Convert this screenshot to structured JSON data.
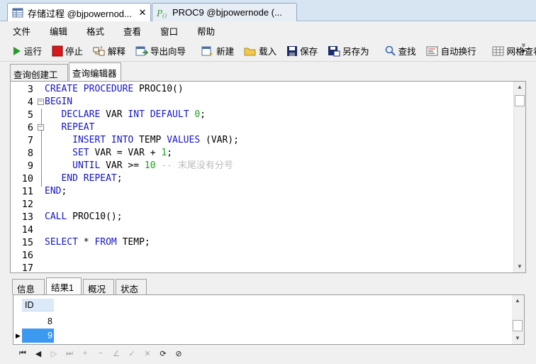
{
  "window_tabs": [
    {
      "label": "存储过程 @bjpowernod...",
      "close": "✕"
    },
    {
      "label": "PROC9 @bjpowernode (..."
    }
  ],
  "menu": [
    "文件",
    "编辑",
    "格式",
    "查看",
    "窗口",
    "帮助"
  ],
  "toolbar": {
    "run": "运行",
    "stop": "停止",
    "explain": "解释",
    "export_wizard": "导出向导",
    "new": "新建",
    "load": "载入",
    "save": "保存",
    "save_as": "另存为",
    "find": "查找",
    "word_wrap": "自动换行",
    "grid_view": "网格查看",
    "more": "»"
  },
  "editor_tabs": [
    "查询创建工具",
    "查询编辑器"
  ],
  "code_lines": [
    {
      "n": "3",
      "fold": "",
      "tokens": [
        {
          "t": "CREATE PROCEDURE",
          "c": "kw"
        },
        {
          "t": " PROC10()",
          "c": "txt"
        }
      ]
    },
    {
      "n": "4",
      "fold": "⊟",
      "tokens": [
        {
          "t": "BEGIN",
          "c": "kw"
        }
      ]
    },
    {
      "n": "5",
      "fold": "",
      "tokens": [
        {
          "t": "   DECLARE",
          "c": "kw"
        },
        {
          "t": " VAR ",
          "c": "txt"
        },
        {
          "t": "INT DEFAULT",
          "c": "kw"
        },
        {
          "t": " ",
          "c": "txt"
        },
        {
          "t": "0",
          "c": "num"
        },
        {
          "t": ";",
          "c": "txt"
        }
      ]
    },
    {
      "n": "6",
      "fold": "⊟",
      "tokens": [
        {
          "t": "   REPEAT",
          "c": "kw"
        }
      ]
    },
    {
      "n": "7",
      "fold": "",
      "tokens": [
        {
          "t": "     INSERT INTO",
          "c": "kw"
        },
        {
          "t": " TEMP ",
          "c": "txt"
        },
        {
          "t": "VALUES",
          "c": "kw"
        },
        {
          "t": " (VAR);",
          "c": "txt"
        }
      ]
    },
    {
      "n": "8",
      "fold": "",
      "tokens": [
        {
          "t": "     SET",
          "c": "kw"
        },
        {
          "t": " VAR = VAR + ",
          "c": "txt"
        },
        {
          "t": "1",
          "c": "num"
        },
        {
          "t": ";",
          "c": "txt"
        }
      ]
    },
    {
      "n": "9",
      "fold": "",
      "tokens": [
        {
          "t": "     UNTIL",
          "c": "kw"
        },
        {
          "t": " VAR >= ",
          "c": "txt"
        },
        {
          "t": "10",
          "c": "num"
        },
        {
          "t": " -- 末尾没有分号",
          "c": "cmt"
        }
      ]
    },
    {
      "n": "10",
      "fold": "",
      "tokens": [
        {
          "t": "   END REPEAT",
          "c": "kw"
        },
        {
          "t": ";",
          "c": "txt"
        }
      ]
    },
    {
      "n": "11",
      "fold": "",
      "tokens": [
        {
          "t": "END",
          "c": "kw"
        },
        {
          "t": ";",
          "c": "txt"
        }
      ]
    },
    {
      "n": "12",
      "fold": "",
      "tokens": []
    },
    {
      "n": "13",
      "fold": "",
      "tokens": [
        {
          "t": "CALL",
          "c": "kw"
        },
        {
          "t": " PROC10();",
          "c": "txt"
        }
      ]
    },
    {
      "n": "14",
      "fold": "",
      "tokens": []
    },
    {
      "n": "15",
      "fold": "",
      "tokens": [
        {
          "t": "SELECT",
          "c": "kw"
        },
        {
          "t": " * ",
          "c": "txt"
        },
        {
          "t": "FROM",
          "c": "kw"
        },
        {
          "t": " TEMP;",
          "c": "txt"
        }
      ]
    },
    {
      "n": "16",
      "fold": "",
      "tokens": []
    },
    {
      "n": "17",
      "fold": "",
      "tokens": []
    }
  ],
  "result_tabs": [
    "信息",
    "结果1",
    "概况",
    "状态"
  ],
  "result_grid": {
    "column": "ID",
    "rows": [
      "8",
      "9"
    ],
    "current_row_marker": "▶"
  },
  "navigator": [
    "first-icon",
    "prev-icon",
    "next-icon",
    "last-icon",
    "insert-icon",
    "delete-icon",
    "edit-icon",
    "apply-icon",
    "cancel-icon",
    "refresh-icon",
    "stop-icon"
  ],
  "colors": {
    "keyword": "#1515c6",
    "number": "#17a317",
    "comment": "#bcbcbc",
    "selected_row": "#3b99f0"
  }
}
